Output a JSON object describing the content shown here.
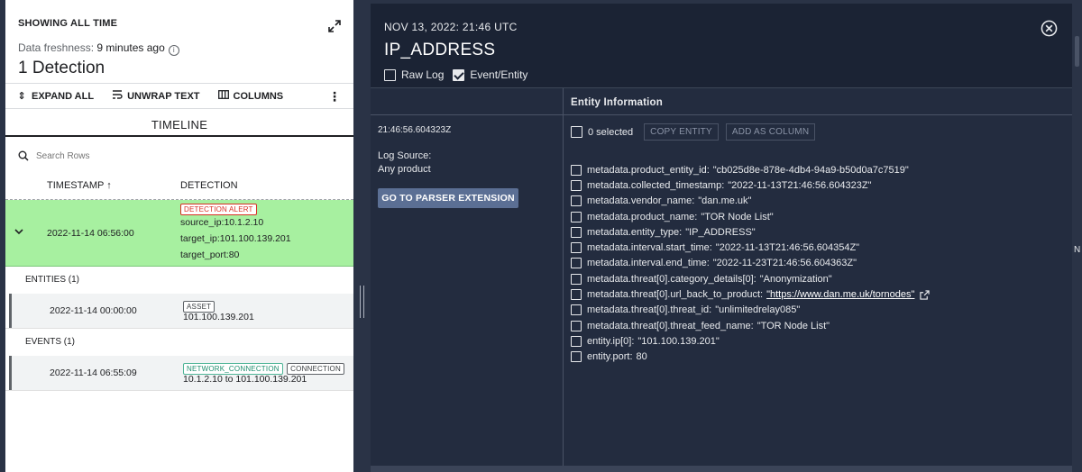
{
  "left": {
    "showing": "SHOWING ALL TIME",
    "freshness_label": "Data freshness:",
    "freshness_value": "9 minutes ago",
    "detections_count": "1 Detection",
    "toolbar": {
      "expand_all": "EXPAND ALL",
      "unwrap_text": "UNWRAP TEXT",
      "columns": "COLUMNS"
    },
    "tab": "TIMELINE",
    "search_placeholder": "Search Rows",
    "columns": {
      "timestamp": "TIMESTAMP ↑",
      "detection": "DETECTION"
    },
    "alert_row": {
      "timestamp": "2022-11-14 06:56:00",
      "badge": "DETECTION ALERT",
      "source_ip": "source_ip:10.1.2.10",
      "target_ip": "target_ip:101.100.139.201",
      "target_port": "target_port:80"
    },
    "entities_label": "ENTITIES (1)",
    "entity_row": {
      "timestamp": "2022-11-14 00:00:00",
      "badge": "ASSET",
      "value": "101.100.139.201"
    },
    "events_label": "EVENTS (1)",
    "event_row": {
      "timestamp": "2022-11-14 06:55:09",
      "badge1": "NETWORK_CONNECTION",
      "badge2": "CONNECTION",
      "value": "10.1.2.10 to 101.100.139.201"
    }
  },
  "right": {
    "date": "NOV 13, 2022: 21:46 UTC",
    "title": "IP_ADDRESS",
    "raw_log": "Raw Log",
    "event_entity": "Event/Entity",
    "meta": {
      "timestamp": "21:46:56.604323Z",
      "log_source_label": "Log Source:",
      "log_source_value": "Any product",
      "parser_button": "GO TO PARSER EXTENSION"
    },
    "entity_header": "Entity Information",
    "selected": "0 selected",
    "copy_entity": "COPY ENTITY",
    "add_as_column": "ADD AS COLUMN",
    "fields": [
      {
        "key": "metadata.product_entity_id:",
        "value": "\"cb025d8e-878e-4db4-94a9-b50d0a7c7519\""
      },
      {
        "key": "metadata.collected_timestamp:",
        "value": "\"2022-11-13T21:46:56.604323Z\""
      },
      {
        "key": "metadata.vendor_name:",
        "value": "\"dan.me.uk\""
      },
      {
        "key": "metadata.product_name:",
        "value": "\"TOR Node List\""
      },
      {
        "key": "metadata.entity_type:",
        "value": "\"IP_ADDRESS\""
      },
      {
        "key": "metadata.interval.start_time:",
        "value": "\"2022-11-13T21:46:56.604354Z\""
      },
      {
        "key": "metadata.interval.end_time:",
        "value": "\"2022-11-23T21:46:56.604363Z\""
      },
      {
        "key": "metadata.threat[0].category_details[0]:",
        "value": "\"Anonymization\""
      },
      {
        "key": "metadata.threat[0].url_back_to_product:",
        "link": "\"https://www.dan.me.uk/tornodes\""
      },
      {
        "key": "metadata.threat[0].threat_id:",
        "value": "\"unlimitedrelay085\""
      },
      {
        "key": "metadata.threat[0].threat_feed_name:",
        "value": "\"TOR Node List\""
      },
      {
        "key": "entity.ip[0]:",
        "value": "\"101.100.139.201\""
      },
      {
        "key": "entity.port:",
        "value": "80"
      }
    ]
  },
  "strip_label": "N",
  "colors": {
    "alert_green": "#a7f0a0",
    "panel_dark": "#1b2334",
    "button_blue": "#5b6f94",
    "badge_red": "#d93025",
    "badge_teal": "#4fb597"
  }
}
